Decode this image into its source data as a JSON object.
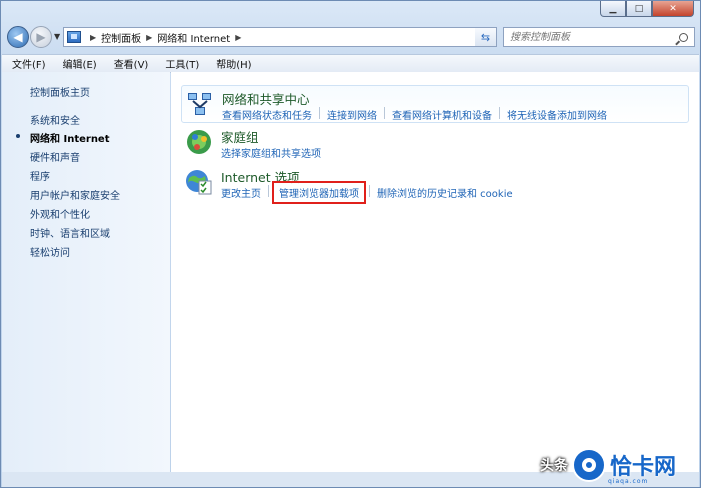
{
  "address_bar": {
    "crumbs": [
      "控制面板",
      "网络和 Internet"
    ]
  },
  "search": {
    "placeholder": "搜索控制面板"
  },
  "menubar": [
    "文件(F)",
    "编辑(E)",
    "查看(V)",
    "工具(T)",
    "帮助(H)"
  ],
  "sidebar": {
    "items": [
      {
        "label": "控制面板主页",
        "active": false
      },
      {
        "label": "系统和安全",
        "active": false
      },
      {
        "label": "网络和 Internet",
        "active": true
      },
      {
        "label": "硬件和声音",
        "active": false
      },
      {
        "label": "程序",
        "active": false
      },
      {
        "label": "用户帐户和家庭安全",
        "active": false
      },
      {
        "label": "外观和个性化",
        "active": false
      },
      {
        "label": "时钟、语言和区域",
        "active": false
      },
      {
        "label": "轻松访问",
        "active": false
      }
    ]
  },
  "categories": [
    {
      "title": "网络和共享中心",
      "icon": "network-icon",
      "links": [
        "查看网络状态和任务",
        "连接到网络",
        "查看网络计算机和设备",
        "将无线设备添加到网络"
      ]
    },
    {
      "title": "家庭组",
      "icon": "homegroup-icon",
      "links": [
        "选择家庭组和共享选项"
      ]
    },
    {
      "title": "Internet 选项",
      "icon": "internet-options-icon",
      "links": [
        "更改主页",
        "管理浏览器加载项",
        "删除浏览的历史记录和 cookie"
      ],
      "highlighted_link": "管理浏览器加载项"
    }
  ],
  "watermark": {
    "prefix": "头条",
    "brand": "恰卡网",
    "sub": "qiaqa.com"
  },
  "colors": {
    "link": "#1f64b6",
    "category_title": "#1e5a2a",
    "highlight_box": "#e0201b"
  }
}
